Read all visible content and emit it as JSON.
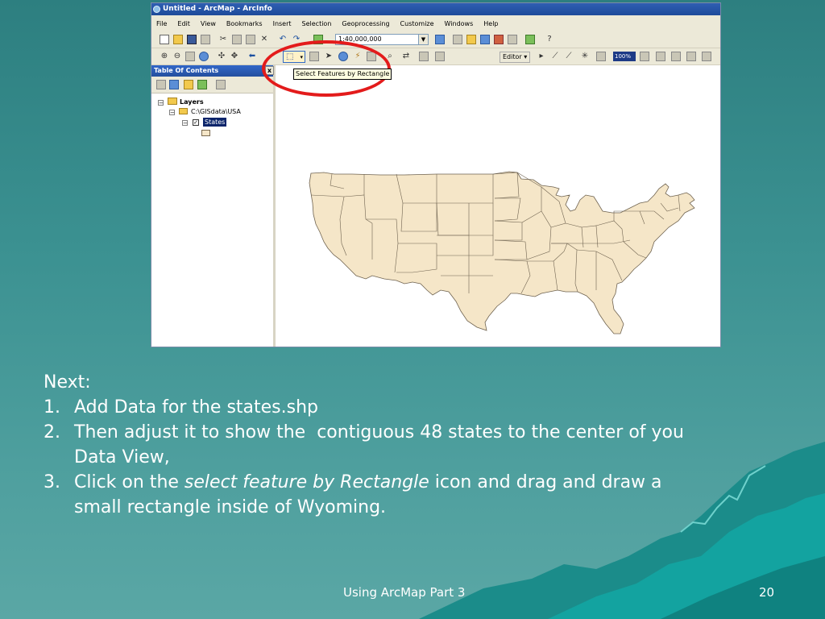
{
  "window": {
    "title": "Untitled - ArcMap - ArcInfo",
    "menu": [
      "File",
      "Edit",
      "View",
      "Bookmarks",
      "Insert",
      "Selection",
      "Geoprocessing",
      "Customize",
      "Windows",
      "Help"
    ],
    "scale_value": "1:40,000,000",
    "editor_label": "Editor ▾",
    "zoom_value": "100%",
    "tooltip": "Select Features by Rectangle",
    "highlight_color": "#e31b1b"
  },
  "toc": {
    "title": "Table Of Contents",
    "layers_label": "Layers",
    "folder_label": "C:\\GISdata\\USA",
    "layer_label": "States",
    "layer_fill": "#f5e6c8"
  },
  "slide": {
    "intro": "Next:",
    "items": [
      {
        "num": "1.",
        "text": "Add Data for the states.shp"
      },
      {
        "num": "2.",
        "text": "Then adjust it to show the  contiguous 48 states to the center of you Data View,"
      },
      {
        "num": "3.",
        "pre": "Click on the ",
        "em": "select feature by Rectangle",
        "post": " icon and drag and draw a small rectangle inside of Wyoming."
      }
    ],
    "footer": "Using ArcMap Part 3",
    "page_number": "20"
  }
}
